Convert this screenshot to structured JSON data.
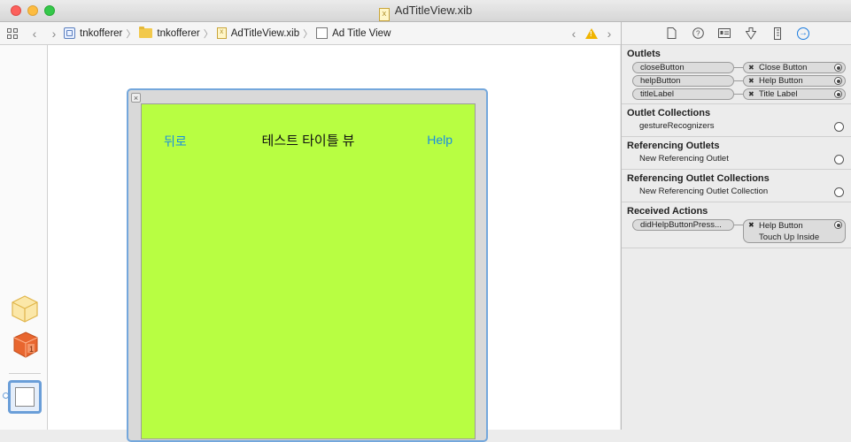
{
  "window": {
    "title": "AdTitleView.xib"
  },
  "jumpbar": {
    "items": [
      "tnkofferer",
      "tnkofferer",
      "AdTitleView.xib",
      "Ad Title View"
    ]
  },
  "canvas": {
    "back_label": "뒤로",
    "title_label": "테스트 타이틀 뷰",
    "help_label": "Help",
    "view_background": "#b8fe42"
  },
  "inspector": {
    "outlets": {
      "heading": "Outlets",
      "rows": [
        {
          "outlet": "closeButton",
          "target": "Close Button"
        },
        {
          "outlet": "helpButton",
          "target": "Help Button"
        },
        {
          "outlet": "titleLabel",
          "target": "Title Label"
        }
      ]
    },
    "outlet_collections": {
      "heading": "Outlet Collections",
      "item": "gestureRecognizers"
    },
    "referencing_outlets": {
      "heading": "Referencing Outlets",
      "item": "New Referencing Outlet"
    },
    "referencing_collections": {
      "heading": "Referencing Outlet Collections",
      "item": "New Referencing Outlet Collection"
    },
    "received_actions": {
      "heading": "Received Actions",
      "action": "didHelpButtonPress...",
      "target": "Help Button",
      "event": "Touch Up Inside"
    }
  }
}
